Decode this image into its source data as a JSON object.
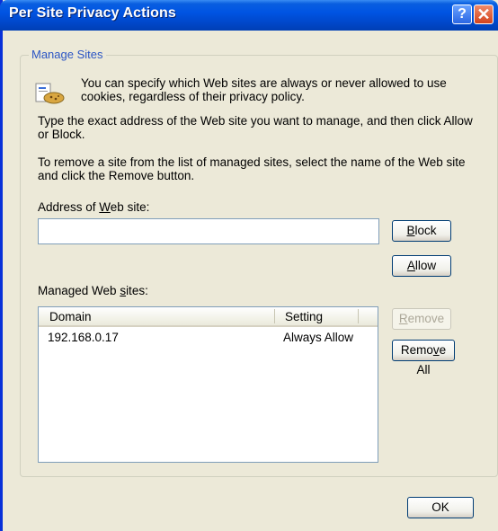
{
  "window": {
    "title": "Per Site Privacy Actions",
    "help_glyph": "?",
    "close_glyph": "✕"
  },
  "group": {
    "legend": "Manage Sites"
  },
  "intro": {
    "line1": "You can specify which Web sites are always or never allowed to use",
    "line2": "cookies, regardless of their privacy policy."
  },
  "para1": {
    "line1": "Type the exact address of the Web site you want to manage, and then click Allow",
    "line2": "or Block."
  },
  "para2": {
    "line1": "To remove a site from the list of managed sites, select the name of the Web site",
    "line2": "and click the Remove button."
  },
  "address": {
    "label_pre": "Address of ",
    "label_access": "W",
    "label_post": "eb site:",
    "value": ""
  },
  "buttons": {
    "block": {
      "access": "B",
      "rest": "lock"
    },
    "allow": {
      "access": "A",
      "rest": "llow"
    },
    "remove": {
      "access": "R",
      "rest": "emove"
    },
    "remove_all": {
      "pre": "Remo",
      "access": "v",
      "post": "e All"
    },
    "ok": "OK"
  },
  "managed": {
    "label_pre": "Managed Web ",
    "label_access": "s",
    "label_post": "ites:"
  },
  "table": {
    "columns": [
      "Domain",
      "Setting"
    ],
    "rows": [
      {
        "domain": "192.168.0.17",
        "setting": "Always Allow"
      }
    ]
  },
  "colors": {
    "titlebar": "#0054e3",
    "face": "#ece9d8",
    "legend": "#2b55c4"
  }
}
